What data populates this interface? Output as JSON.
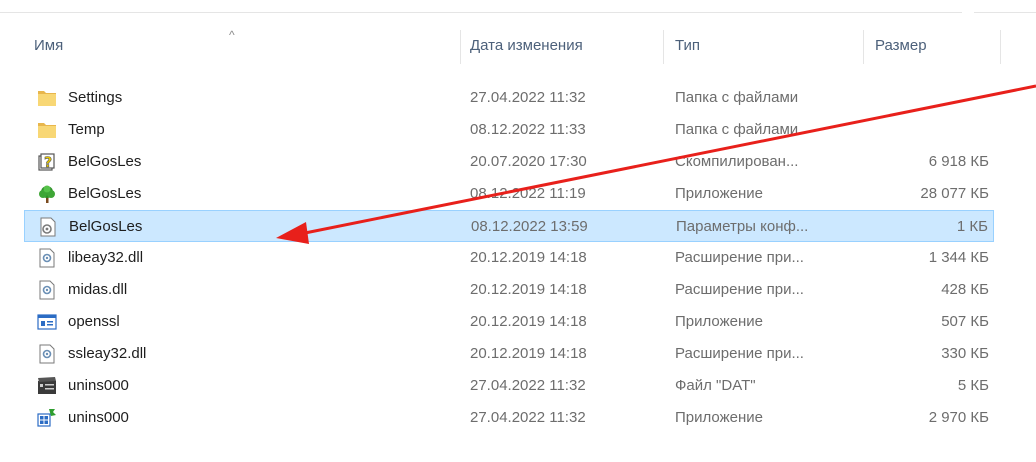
{
  "header": {
    "name": "Имя",
    "date": "Дата изменения",
    "type": "Тип",
    "size": "Размер",
    "sort_indicator": "^"
  },
  "files": [
    {
      "name": "Settings",
      "date": "27.04.2022 11:32",
      "type": "Папка с файлами",
      "size": "",
      "icon": "folder-icon"
    },
    {
      "name": "Temp",
      "date": "08.12.2022 11:33",
      "type": "Папка с файлами",
      "size": "",
      "icon": "folder-icon"
    },
    {
      "name": "BelGosLes",
      "date": "20.07.2020 17:30",
      "type": "Скомпилирован...",
      "size": "6 918 КБ",
      "icon": "help-file-icon"
    },
    {
      "name": "BelGosLes",
      "date": "08.12.2022 11:19",
      "type": "Приложение",
      "size": "28 077 КБ",
      "icon": "tree-app-icon"
    },
    {
      "name": "BelGosLes",
      "date": "08.12.2022 13:59",
      "type": "Параметры конф...",
      "size": "1 КБ",
      "icon": "config-file-icon",
      "selected": true
    },
    {
      "name": "libeay32.dll",
      "date": "20.12.2019 14:18",
      "type": "Расширение при...",
      "size": "1 344 КБ",
      "icon": "dll-icon"
    },
    {
      "name": "midas.dll",
      "date": "20.12.2019 14:18",
      "type": "Расширение при...",
      "size": "428 КБ",
      "icon": "dll-icon"
    },
    {
      "name": "openssl",
      "date": "20.12.2019 14:18",
      "type": "Приложение",
      "size": "507 КБ",
      "icon": "window-app-icon"
    },
    {
      "name": "ssleay32.dll",
      "date": "20.12.2019 14:18",
      "type": "Расширение при...",
      "size": "330 КБ",
      "icon": "dll-icon"
    },
    {
      "name": "unins000",
      "date": "27.04.2022 11:32",
      "type": "Файл \"DAT\"",
      "size": "5 КБ",
      "icon": "dat-file-icon"
    },
    {
      "name": "unins000",
      "date": "27.04.2022 11:32",
      "type": "Приложение",
      "size": "2 970 КБ",
      "icon": "installer-icon"
    }
  ],
  "colors": {
    "selected_bg": "#cce8ff",
    "selected_border": "#99d1ff",
    "annotation_arrow": "#e8201b"
  }
}
